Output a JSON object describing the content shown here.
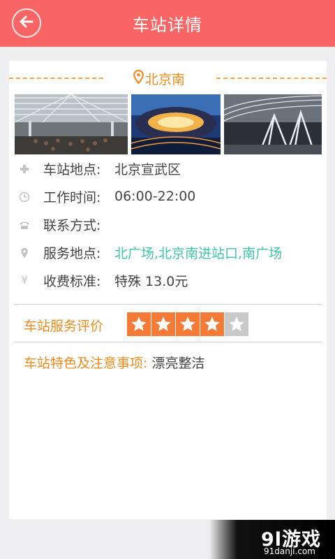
{
  "header": {
    "title": "车站详情",
    "back_icon": "arrow-left-icon"
  },
  "station": {
    "name": "北京南",
    "pin_icon": "location-pin-icon",
    "accent": "#f28a1c"
  },
  "photos": [
    {
      "name": "station-interior-hall"
    },
    {
      "name": "station-aerial-night"
    },
    {
      "name": "station-concourse-arches"
    }
  ],
  "info": [
    {
      "icon": "plus-icon",
      "label": "车站地点:",
      "value": "北京宣武区",
      "color": "#444444"
    },
    {
      "icon": "clock-icon",
      "label": "工作时间:",
      "value": "06:00-22:00",
      "color": "#444444"
    },
    {
      "icon": "phone-icon",
      "label": "联系方式:",
      "value": "",
      "color": "#444444"
    },
    {
      "icon": "location-icon",
      "label": "服务地点:",
      "value": "北广场,北京南进站口,南广场",
      "color": "#3fc6a8"
    },
    {
      "icon": "yen-icon",
      "label": "收费标准:",
      "value": "特殊 13.0元",
      "color": "#444444"
    }
  ],
  "rating": {
    "label": "车站服务评价",
    "value": 4,
    "max": 5
  },
  "notes": {
    "label": "车站特色及注意事项:",
    "value": " 漂亮整洁"
  },
  "watermark": {
    "main": "9l游戏",
    "sub": "91danji.com"
  },
  "colors": {
    "header": "#f96564",
    "star_on": "#f47a36",
    "star_off": "#c9c9c9"
  }
}
